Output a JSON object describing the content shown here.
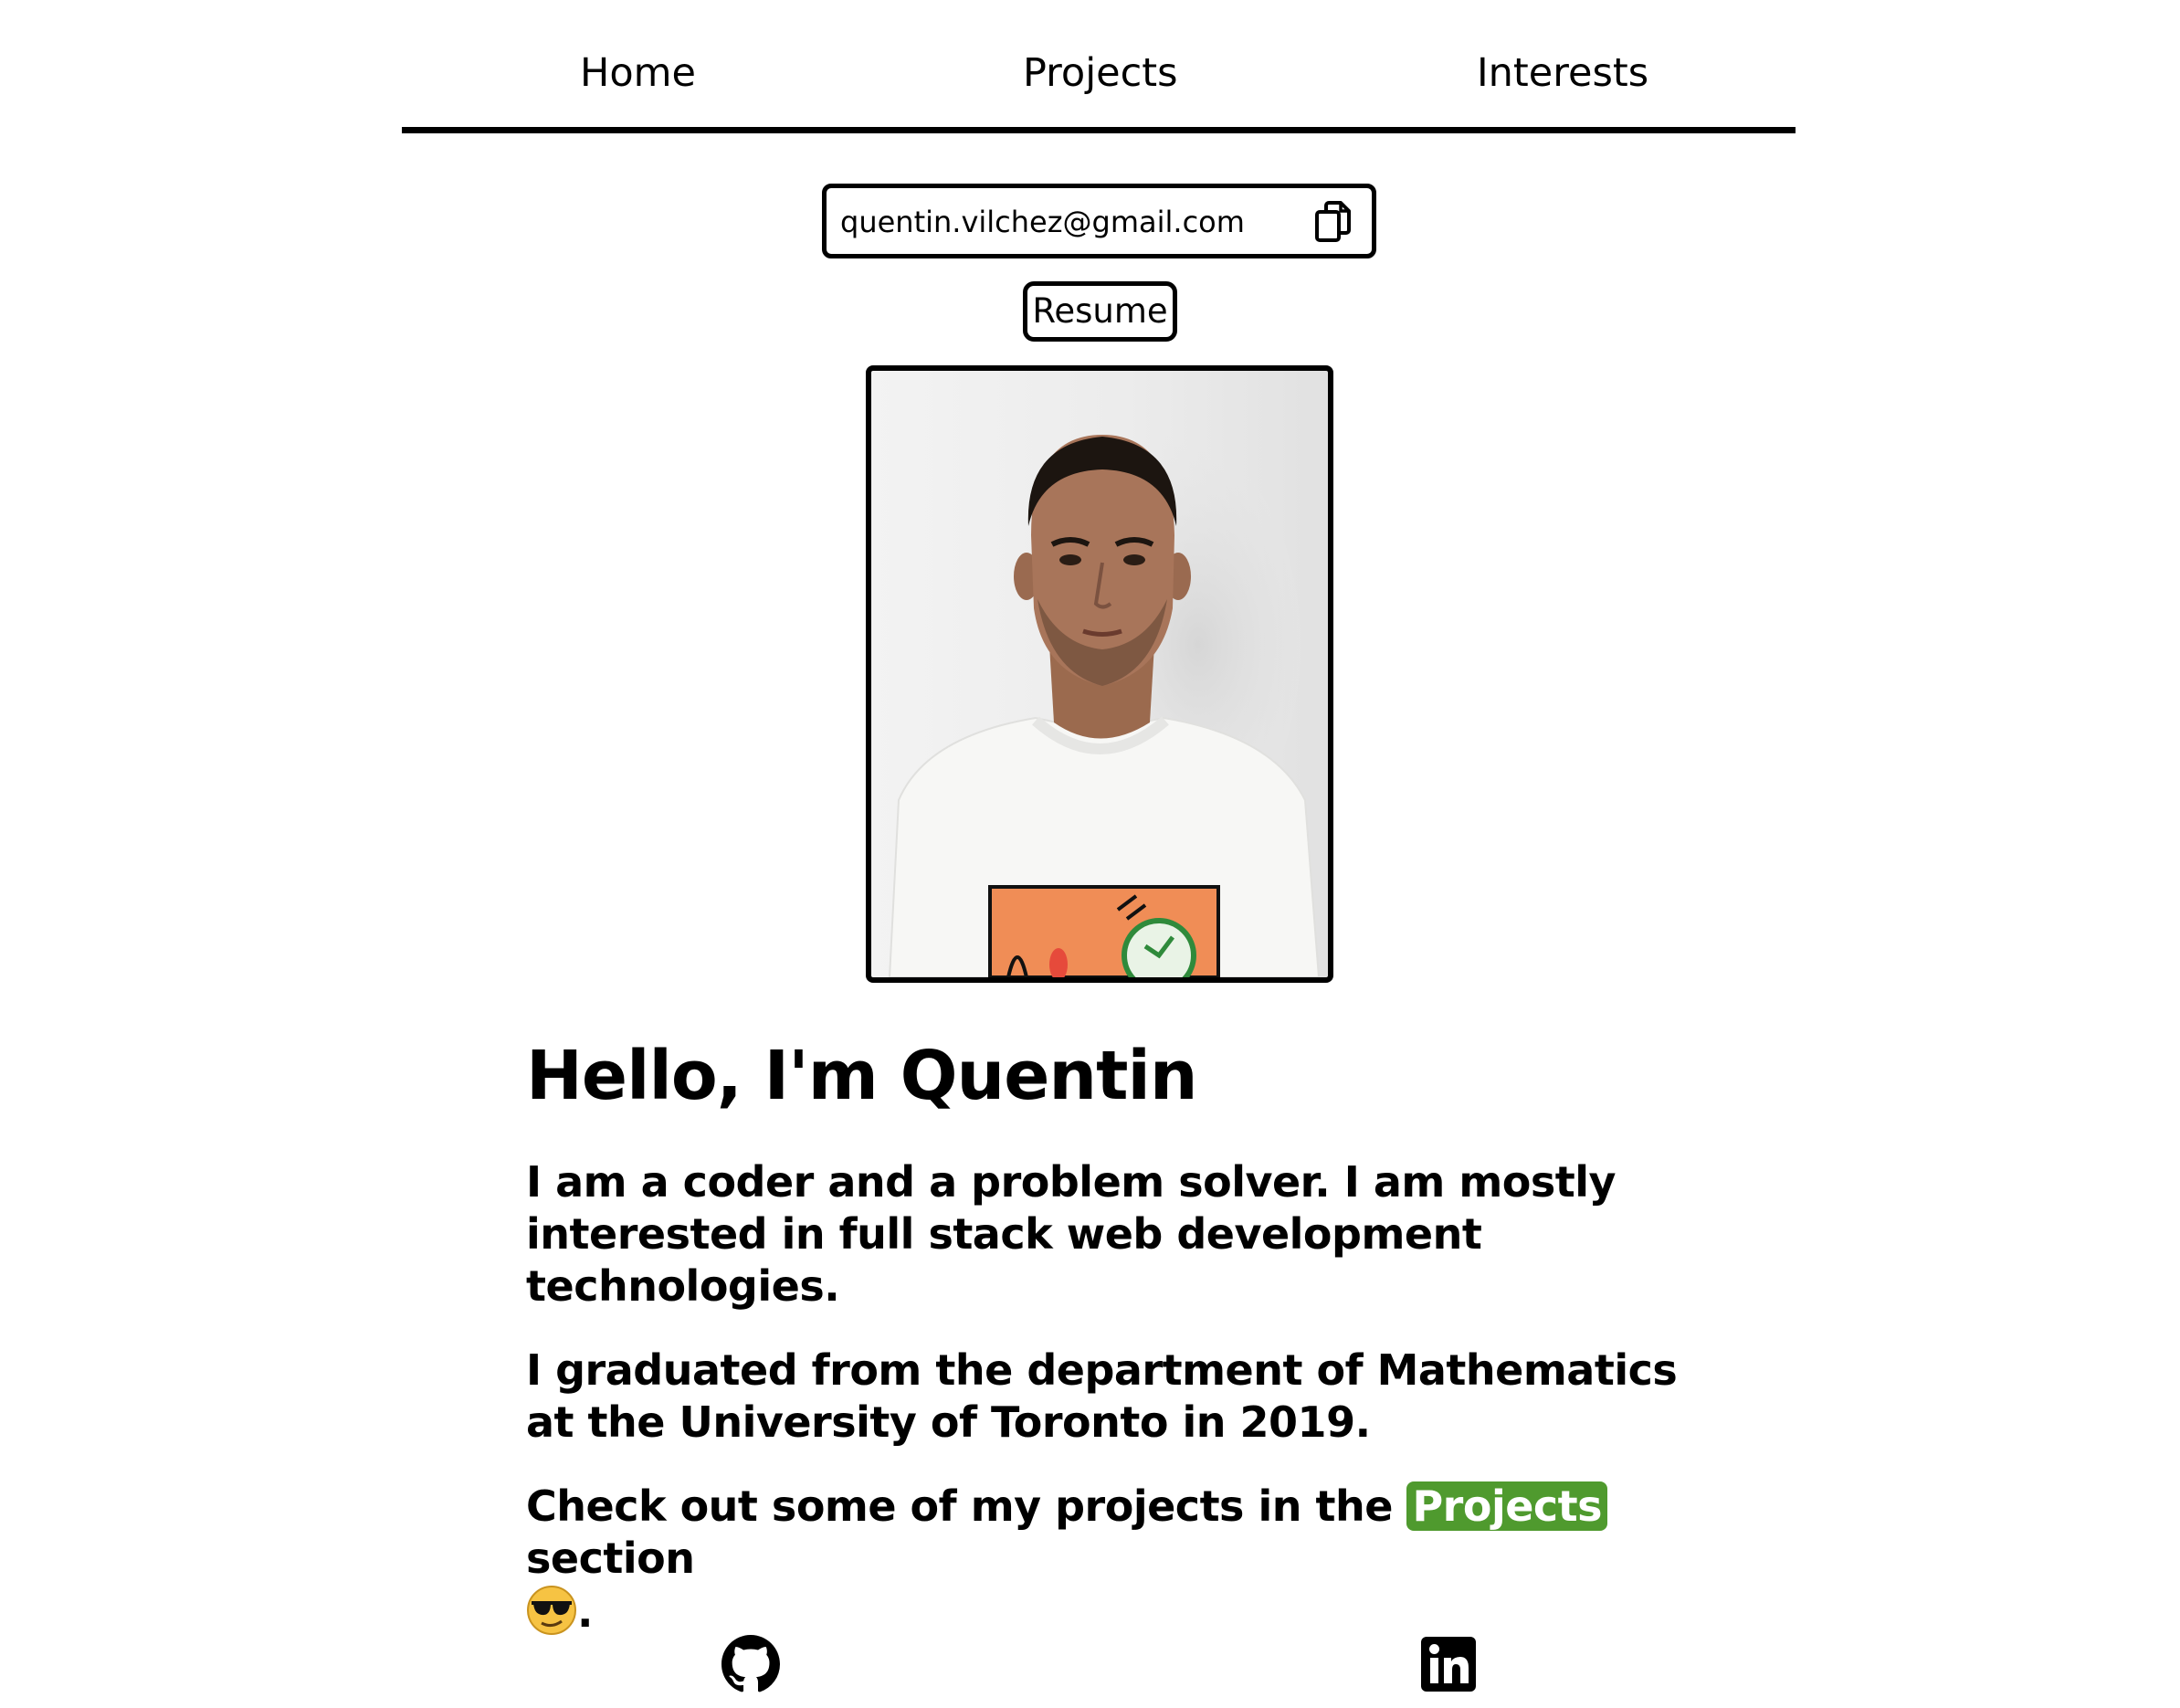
{
  "nav": {
    "items": [
      {
        "label": "Home"
      },
      {
        "label": "Projects"
      },
      {
        "label": "Interests"
      }
    ]
  },
  "contact": {
    "email": "quentin.vilchez@gmail.com",
    "copy_icon": "copy-icon",
    "resume_label": "Resume"
  },
  "profile": {
    "photo": "profile-photo"
  },
  "bio": {
    "title": "Hello, I'm Quentin",
    "para1": "I am a coder and a problem solver. I am mostly interested in full stack web development technologies.",
    "para2": "I graduated from the department of Mathematics at the University of Toronto in 2019.",
    "para3_before": "Check out some of my projects in the ",
    "para3_link": "Projects",
    "para3_after": " section",
    "para3_end": ".",
    "emoji": "sunglasses-emoji"
  },
  "social": {
    "github_icon": "github-icon",
    "linkedin_icon": "linkedin-icon"
  },
  "colors": {
    "accent": "#4f9a2e",
    "text": "#000000",
    "background": "#ffffff"
  }
}
